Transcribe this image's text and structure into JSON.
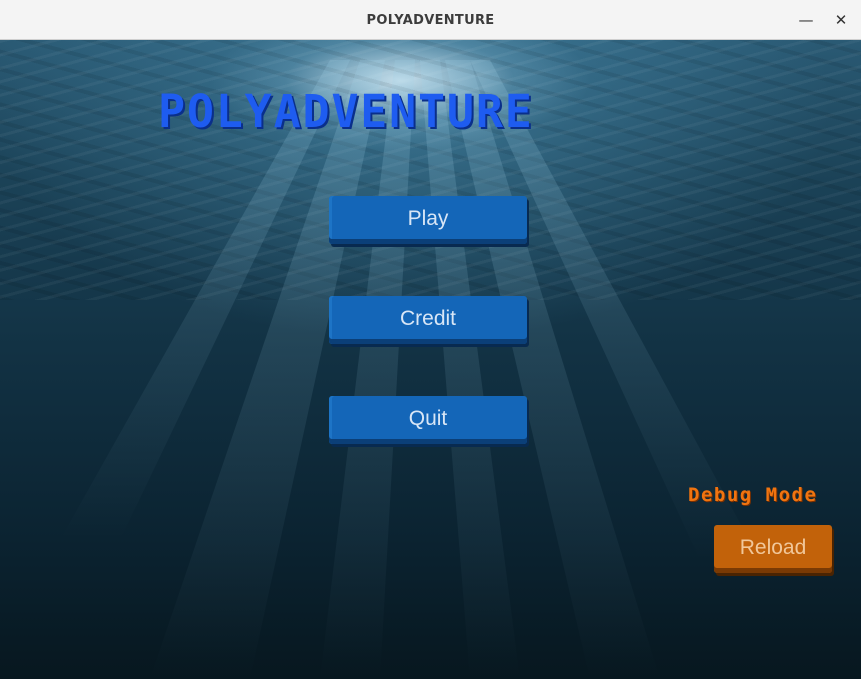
{
  "window": {
    "title": "POLYADVENTURE",
    "minimize_glyph": "—",
    "close_glyph": "✕"
  },
  "game": {
    "logo_text": "POLYADVENTURE",
    "background": "underwater-scene",
    "menu": {
      "play_label": "Play",
      "credit_label": "Credit",
      "quit_label": "Quit"
    },
    "debug": {
      "label": "Debug Mode",
      "reload_label": "Reload"
    }
  },
  "colors": {
    "logo": "#1e5cf0",
    "menu_button": "#1466b8",
    "debug_label": "#f07410",
    "reload_button": "#c2620a"
  }
}
